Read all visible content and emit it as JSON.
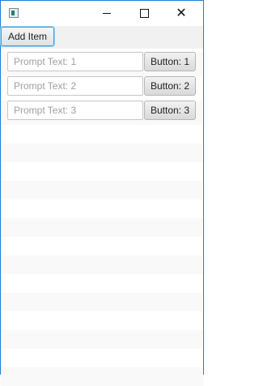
{
  "window": {
    "title": "",
    "app_icon": "app-window-icon",
    "controls": [
      "minimize-icon",
      "maximize-icon",
      "close-icon"
    ]
  },
  "toolbar": {
    "add_item_label": "Add Item"
  },
  "items": [
    {
      "placeholder": "Prompt Text: 1",
      "value": "",
      "button_label": "Button: 1"
    },
    {
      "placeholder": "Prompt Text: 2",
      "value": "",
      "button_label": "Button: 2"
    },
    {
      "placeholder": "Prompt Text: 3",
      "value": "",
      "button_label": "Button: 3"
    }
  ]
}
